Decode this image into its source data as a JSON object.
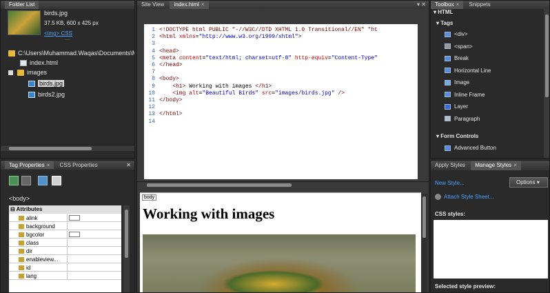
{
  "folder_list": {
    "tab": "Folder List",
    "file_name": "birds.jpg",
    "file_info": "37.5 KB, 600 x 425 px",
    "links": "<img> CSS",
    "dots": "....",
    "path": "C:\\Users\\Muhammad.Waqas\\Documents\\M",
    "items": [
      "index.html",
      "images",
      "birds.jpg",
      "birds2.jpg"
    ]
  },
  "editor": {
    "tabs": [
      "Site View",
      "index.html"
    ],
    "close": "×",
    "lines": [
      {
        "n": "1",
        "html": "<span class='tag'>&lt;!DOCTYPE html PUBLIC \"-//W3C//DTD XHTML 1.0 Transitional//EN\" \"ht</span>"
      },
      {
        "n": "2",
        "html": "<span class='tag'>&lt;html</span> <span class='att'>xmlns</span>=<span class='val'>\"http://www.w3.org/1999/xhtml\"</span><span class='tag'>&gt;</span>"
      },
      {
        "n": "3",
        "html": ""
      },
      {
        "n": "4",
        "html": "<span class='tag'>&lt;head&gt;</span>"
      },
      {
        "n": "5",
        "html": "<span class='tag'>&lt;meta</span> <span class='att'>content</span>=<span class='val'>\"text/html; charset=utf-8\"</span> <span class='att'>http-equiv</span>=<span class='val'>\"Content-Type\"</span>"
      },
      {
        "n": "6",
        "html": "<span class='tag'>&lt;/head&gt;</span>"
      },
      {
        "n": "7",
        "html": ""
      },
      {
        "n": "8",
        "html": "<span class='tag'>&lt;body&gt;</span>"
      },
      {
        "n": "9",
        "html": "&nbsp;&nbsp;&nbsp;&nbsp;<span class='tag'>&lt;h1&gt;</span><span class='txt'> Working with images </span><span class='tag'>&lt;/h1&gt;</span>"
      },
      {
        "n": "10",
        "html": "&nbsp;&nbsp;&nbsp;&nbsp;<span class='tag'>&lt;img</span> <span class='att'>alt</span>=<span class='val'>\"Beautiful Birds\"</span> <span class='att'>src</span>=<span class='val'>\"images/birds.jpg\"</span> <span class='tag'>/&gt;</span>"
      },
      {
        "n": "11",
        "html": "<span class='tag'>&lt;/body&gt;</span>"
      },
      {
        "n": "12",
        "html": ""
      },
      {
        "n": "13",
        "html": "<span class='tag'>&lt;/html&gt;</span>"
      },
      {
        "n": "14",
        "html": ""
      }
    ],
    "design_tag": "body",
    "design_heading": "Working with images"
  },
  "tag_props": {
    "tabs": [
      "Tag Properties",
      "CSS Properties"
    ],
    "close": "×",
    "crumb": "<body>",
    "section": "Attributes",
    "attrs": [
      "alink",
      "background",
      "bgcolor",
      "class",
      "dir",
      "enableview...",
      "id",
      "lang"
    ]
  },
  "toolbox": {
    "tabs": [
      "Toolbox",
      "Snippets"
    ],
    "close": "×",
    "html": "HTML",
    "tags": "Tags",
    "tag_items": [
      "<div>",
      "<span>",
      "Break",
      "Horizontal Line",
      "Image",
      "Inline Frame",
      "Layer",
      "Paragraph"
    ],
    "form": "Form Controls",
    "form_items": [
      "Advanced Button"
    ]
  },
  "styles": {
    "tabs": [
      "Apply Styles",
      "Manage Styles"
    ],
    "close": "×",
    "new_style": "New Style...",
    "options": "Options",
    "attach": "Attach Style Sheet...",
    "css_styles": "CSS styles:",
    "preview": "Selected style preview:"
  },
  "colors": {
    "bg": "#2b2b2b",
    "panel": "#2a2a2a",
    "link": "#4da3ff",
    "code_bg": "#ffffff"
  }
}
